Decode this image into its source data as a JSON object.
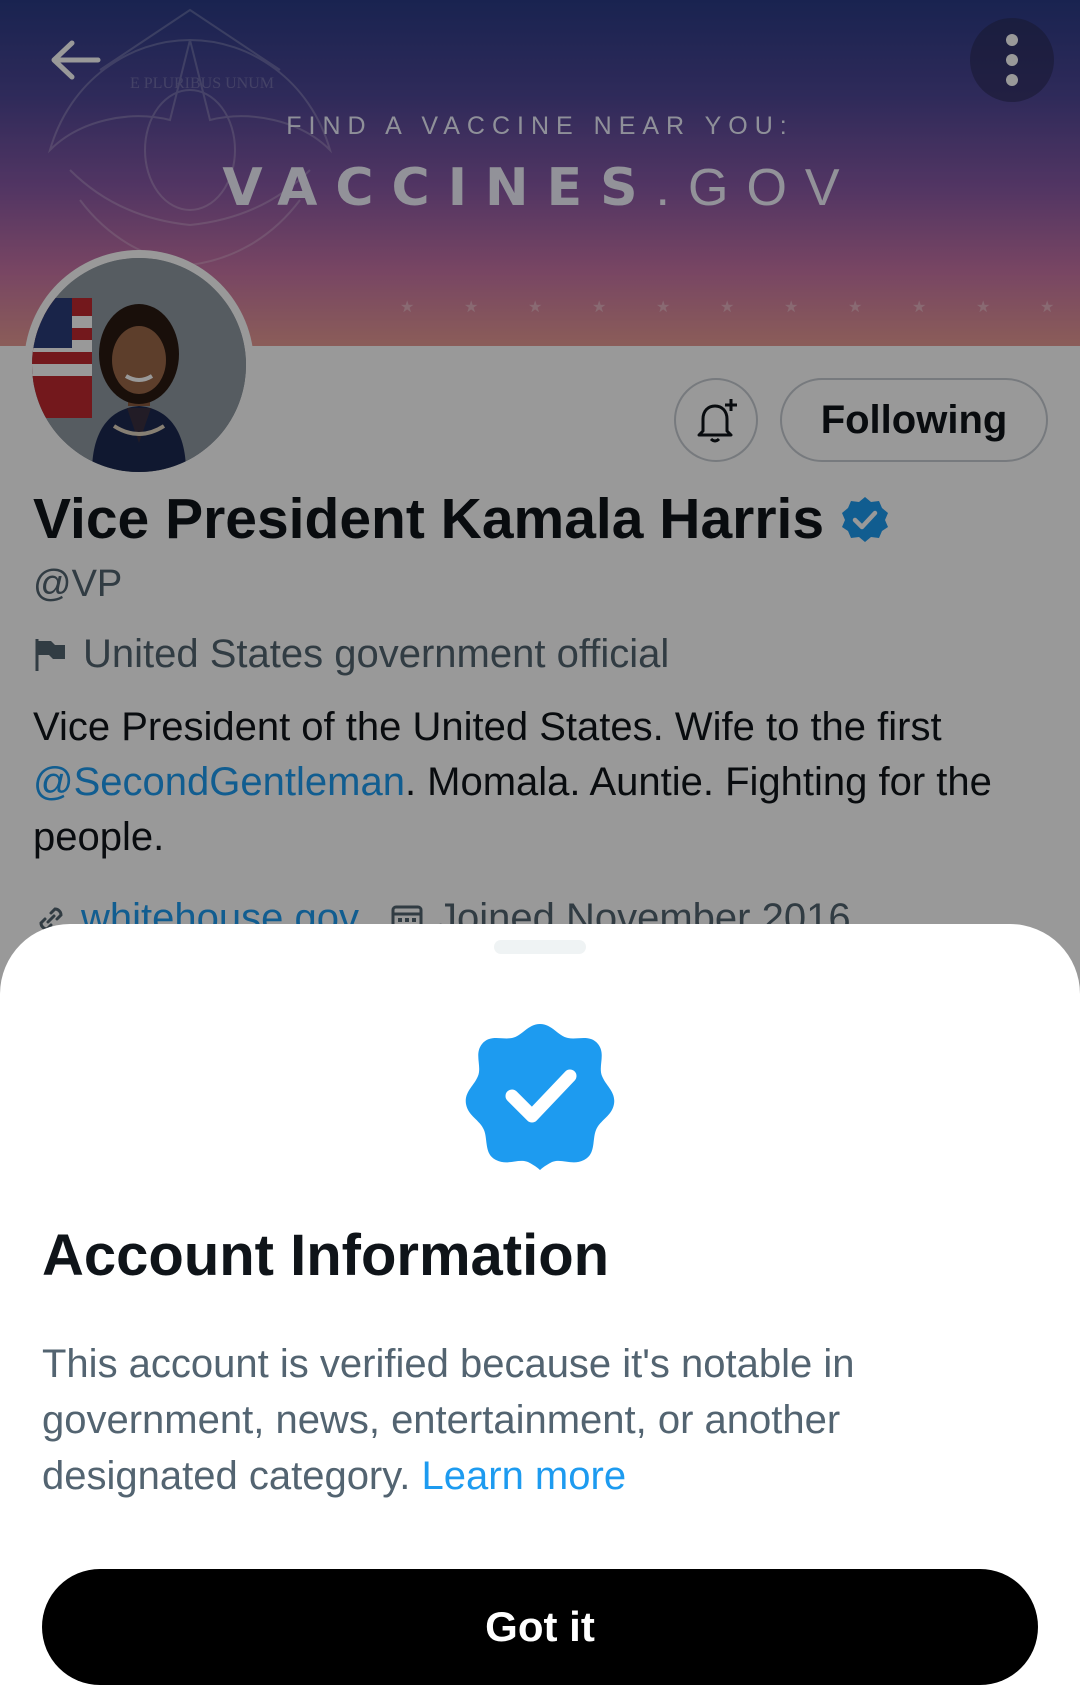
{
  "banner": {
    "tagline": "FIND A VACCINE NEAR YOU:",
    "site_main": "VACCINES",
    "site_suffix": ".GOV",
    "seal_text": "E PLURIBUS UNUM"
  },
  "header": {
    "back_icon": "arrow-left-icon",
    "more_icon": "more-vertical-icon"
  },
  "profile": {
    "display_name": "Vice President Kamala Harris",
    "handle": "@VP",
    "label": "United States government official",
    "bio_part1": "Vice President of the United States. Wife to the first ",
    "bio_mention": "@SecondGentleman",
    "bio_part2": ". Momala. Auntie. Fighting for the people.",
    "website": "whitehouse.gov",
    "joined": "Joined November 2016",
    "follow_button": "Following",
    "notify_icon": "bell-plus-icon"
  },
  "sheet": {
    "title": "Account Information",
    "body": "This account is verified because it's notable in government, news, entertainment, or another designated category. ",
    "learn_more": "Learn more",
    "button": "Got it",
    "badge_icon": "verified-badge-icon"
  },
  "colors": {
    "accent": "#1d9bf0",
    "text_primary": "#0f1419",
    "text_secondary": "#536471",
    "button_bg": "#000000"
  }
}
